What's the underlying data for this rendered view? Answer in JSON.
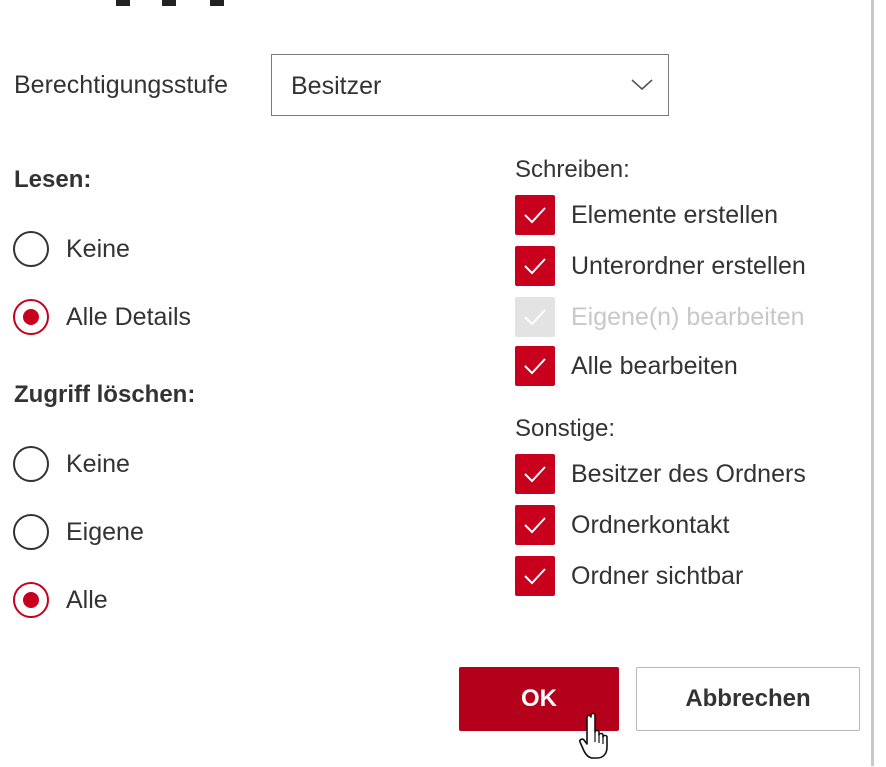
{
  "dialog": {
    "permission_level": {
      "label": "Berechtigungsstufe",
      "selected": "Besitzer",
      "chevron_icon": "chevron-down-icon"
    },
    "read": {
      "heading": "Lesen:",
      "options": [
        {
          "label": "Keine",
          "selected": false
        },
        {
          "label": "Alle Details",
          "selected": true
        }
      ]
    },
    "delete": {
      "heading": "Zugriff löschen:",
      "options": [
        {
          "label": "Keine",
          "selected": false
        },
        {
          "label": "Eigene",
          "selected": false
        },
        {
          "label": "Alle",
          "selected": true
        }
      ]
    },
    "write": {
      "heading": "Schreiben:",
      "options": [
        {
          "label": "Elemente erstellen",
          "checked": true,
          "disabled": false
        },
        {
          "label": "Unterordner erstellen",
          "checked": true,
          "disabled": false
        },
        {
          "label": "Eigene(n) bearbeiten",
          "checked": true,
          "disabled": true
        },
        {
          "label": "Alle bearbeiten",
          "checked": true,
          "disabled": false
        }
      ]
    },
    "other": {
      "heading": "Sonstige:",
      "options": [
        {
          "label": "Besitzer des Ordners",
          "checked": true
        },
        {
          "label": "Ordnerkontakt",
          "checked": true
        },
        {
          "label": "Ordner sichtbar",
          "checked": true
        }
      ]
    },
    "buttons": {
      "ok": "OK",
      "cancel": "Abbrechen"
    }
  },
  "colors": {
    "accent": "#c8001e",
    "ok_button": "#b4001a",
    "disabled_check": "#e3e3e3"
  }
}
